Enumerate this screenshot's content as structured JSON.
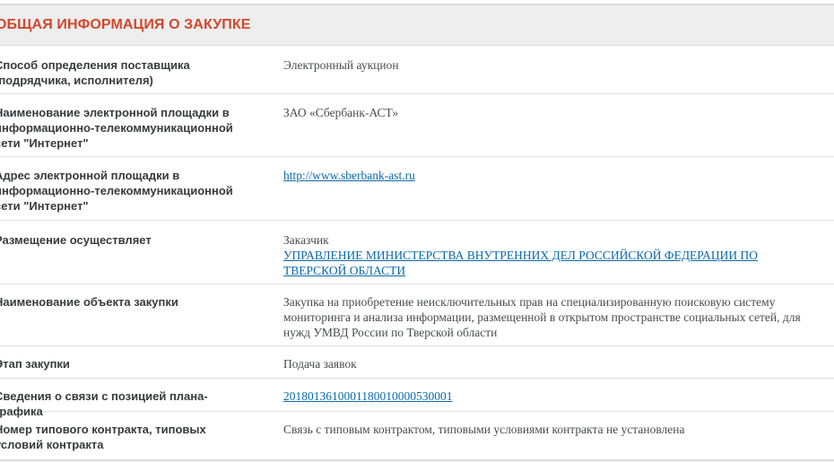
{
  "section": {
    "title": "ОБЩАЯ ИНФОРМАЦИЯ О ЗАКУПКЕ"
  },
  "rows": [
    {
      "label": "Способ определения поставщика (подрядчика, исполнителя)",
      "value": "Электронный аукцион"
    },
    {
      "label": "Наименование электронной площадки в информационно-телекоммуникационной сети \"Интернет\"",
      "value": "ЗАО «Сбербанк-АСТ»"
    },
    {
      "label": "Адрес электронной площадки в информационно-телекоммуникационной сети \"Интернет\"",
      "link": "http://www.sberbank-ast.ru"
    },
    {
      "label": "Размещение осуществляет",
      "value": "Заказчик",
      "link": "УПРАВЛЕНИЕ МИНИСТЕРСТВА ВНУТРЕННИХ ДЕЛ РОССИЙСКОЙ ФЕДЕРАЦИИ ПО ТВЕРСКОЙ ОБЛАСТИ"
    },
    {
      "label": "Наименование объекта закупки",
      "value": "Закупка на приобретение неисключительных прав на специализированную поисковую систему мониторинга и анализа информации, размещенной в открытом пространстве социальных сетей, для нужд УМВД России по Тверской области"
    },
    {
      "label": "Этап закупки",
      "value": "Подача заявок"
    },
    {
      "label": "Сведения о связи с позицией плана-графика",
      "link": "2018013610001180010000530001"
    },
    {
      "label": "Номер типового контракта, типовых условий контракта",
      "value": "Связь с типовым контрактом, типовыми условиями контракта не установлена"
    }
  ]
}
